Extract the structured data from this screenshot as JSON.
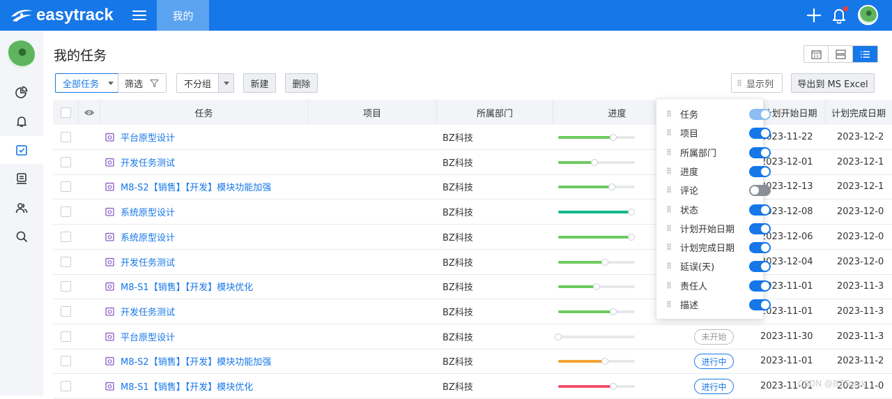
{
  "app": {
    "name": "easytrack",
    "top_tab": "我的"
  },
  "page": {
    "title": "我的任务"
  },
  "toolbar": {
    "task_scope": "全部任务",
    "filter_label": "筛选",
    "group_label": "不分组",
    "new_label": "新建",
    "delete_label": "删除",
    "columns_label": "显示列",
    "export_label": "导出到 MS Excel"
  },
  "table": {
    "headers": {
      "task": "任务",
      "project": "项目",
      "department": "所属部门",
      "progress": "进度",
      "start_date": "计划开始日期",
      "end_date": "计划完成日期"
    },
    "rows": [
      {
        "task": "平台原型设计",
        "department": "BZ科技",
        "progress": 0.72,
        "progress_color": "#6ccb5f",
        "status": "",
        "start": "2023-11-22",
        "end": "2023-12-2"
      },
      {
        "task": "开发任务测试",
        "department": "BZ科技",
        "progress": 0.47,
        "progress_color": "#6ccb5f",
        "status": "",
        "start": "2023-12-01",
        "end": "2023-12-1"
      },
      {
        "task": "M8-S2【销售】【开发】模块功能加强",
        "department": "BZ科技",
        "progress": 0.7,
        "progress_color": "#6ccb5f",
        "status": "",
        "start": "2023-12-13",
        "end": "2023-12-1"
      },
      {
        "task": "系统原型设计",
        "department": "BZ科技",
        "progress": 0.95,
        "progress_color": "#12b886",
        "status": "",
        "start": "2023-12-08",
        "end": "2023-12-0"
      },
      {
        "task": "系统原型设计",
        "department": "BZ科技",
        "progress": 0.95,
        "progress_color": "#6ccb5f",
        "status": "",
        "start": "2023-12-06",
        "end": "2023-12-0"
      },
      {
        "task": "开发任务测试",
        "department": "BZ科技",
        "progress": 0.61,
        "progress_color": "#6ccb5f",
        "status": "",
        "start": "2023-12-04",
        "end": "2023-12-0"
      },
      {
        "task": "M8-S1【销售】【开发】模块优化",
        "department": "BZ科技",
        "progress": 0.5,
        "progress_color": "#6ccb5f",
        "status": "",
        "start": "2023-11-01",
        "end": "2023-11-3"
      },
      {
        "task": "开发任务测试",
        "department": "BZ科技",
        "progress": 0.72,
        "progress_color": "#6ccb5f",
        "status": "",
        "start": "2023-11-01",
        "end": "2023-11-3"
      },
      {
        "task": "平台原型设计",
        "department": "BZ科技",
        "progress": 0.0,
        "progress_color": "#6ccb5f",
        "status": "未开始",
        "start": "2023-11-30",
        "end": "2023-11-3"
      },
      {
        "task": "M8-S2【销售】【开发】模块功能加强",
        "department": "BZ科技",
        "progress": 0.61,
        "progress_color": "#f5a233",
        "status": "进行中",
        "start": "2023-11-01",
        "end": "2023-11-2"
      },
      {
        "task": "M8-S1【销售】【开发】模块优化",
        "department": "BZ科技",
        "progress": 0.72,
        "progress_color": "#f0506e",
        "status": "进行中",
        "start": "2023-11-01",
        "end": "2023-11-0"
      }
    ]
  },
  "column_popup": {
    "items": [
      {
        "label": "任务",
        "on": true,
        "locked": true
      },
      {
        "label": "项目",
        "on": true
      },
      {
        "label": "所属部门",
        "on": true
      },
      {
        "label": "进度",
        "on": true
      },
      {
        "label": "评论",
        "on": false
      },
      {
        "label": "状态",
        "on": true
      },
      {
        "label": "计划开始日期",
        "on": true
      },
      {
        "label": "计划完成日期",
        "on": true
      },
      {
        "label": "延误(天)",
        "on": true
      },
      {
        "label": "责任人",
        "on": true
      },
      {
        "label": "描述",
        "on": true
      }
    ]
  },
  "watermark": "CSDN @BZTrack",
  "colors": {
    "brand": "#1677e8",
    "link": "#1677e8",
    "sidebar_bg": "#f3f5f8"
  }
}
